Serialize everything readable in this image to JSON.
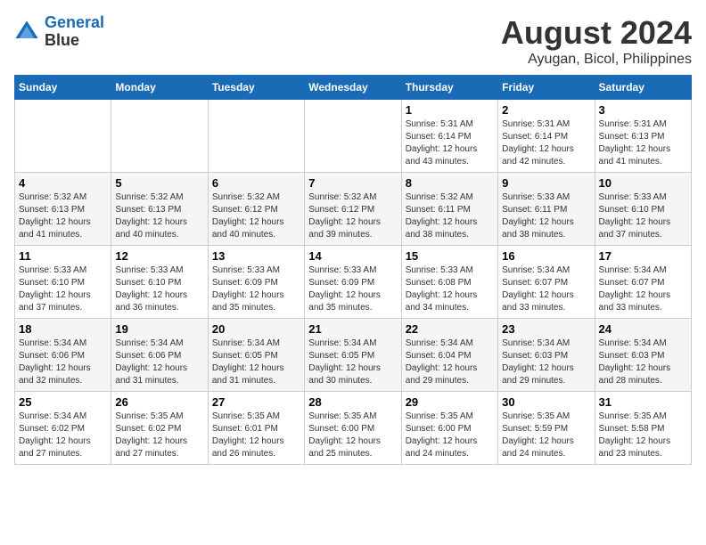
{
  "app": {
    "name": "GeneralBlue",
    "logo_text_line1": "General",
    "logo_text_line2": "Blue"
  },
  "calendar": {
    "title": "August 2024",
    "subtitle": "Ayugan, Bicol, Philippines",
    "days_of_week": [
      "Sunday",
      "Monday",
      "Tuesday",
      "Wednesday",
      "Thursday",
      "Friday",
      "Saturday"
    ],
    "weeks": [
      [
        {
          "day": "",
          "sunrise": "",
          "sunset": "",
          "daylight": ""
        },
        {
          "day": "",
          "sunrise": "",
          "sunset": "",
          "daylight": ""
        },
        {
          "day": "",
          "sunrise": "",
          "sunset": "",
          "daylight": ""
        },
        {
          "day": "",
          "sunrise": "",
          "sunset": "",
          "daylight": ""
        },
        {
          "day": "1",
          "sunrise": "Sunrise: 5:31 AM",
          "sunset": "Sunset: 6:14 PM",
          "daylight": "Daylight: 12 hours and 43 minutes."
        },
        {
          "day": "2",
          "sunrise": "Sunrise: 5:31 AM",
          "sunset": "Sunset: 6:14 PM",
          "daylight": "Daylight: 12 hours and 42 minutes."
        },
        {
          "day": "3",
          "sunrise": "Sunrise: 5:31 AM",
          "sunset": "Sunset: 6:13 PM",
          "daylight": "Daylight: 12 hours and 41 minutes."
        }
      ],
      [
        {
          "day": "4",
          "sunrise": "Sunrise: 5:32 AM",
          "sunset": "Sunset: 6:13 PM",
          "daylight": "Daylight: 12 hours and 41 minutes."
        },
        {
          "day": "5",
          "sunrise": "Sunrise: 5:32 AM",
          "sunset": "Sunset: 6:13 PM",
          "daylight": "Daylight: 12 hours and 40 minutes."
        },
        {
          "day": "6",
          "sunrise": "Sunrise: 5:32 AM",
          "sunset": "Sunset: 6:12 PM",
          "daylight": "Daylight: 12 hours and 40 minutes."
        },
        {
          "day": "7",
          "sunrise": "Sunrise: 5:32 AM",
          "sunset": "Sunset: 6:12 PM",
          "daylight": "Daylight: 12 hours and 39 minutes."
        },
        {
          "day": "8",
          "sunrise": "Sunrise: 5:32 AM",
          "sunset": "Sunset: 6:11 PM",
          "daylight": "Daylight: 12 hours and 38 minutes."
        },
        {
          "day": "9",
          "sunrise": "Sunrise: 5:33 AM",
          "sunset": "Sunset: 6:11 PM",
          "daylight": "Daylight: 12 hours and 38 minutes."
        },
        {
          "day": "10",
          "sunrise": "Sunrise: 5:33 AM",
          "sunset": "Sunset: 6:10 PM",
          "daylight": "Daylight: 12 hours and 37 minutes."
        }
      ],
      [
        {
          "day": "11",
          "sunrise": "Sunrise: 5:33 AM",
          "sunset": "Sunset: 6:10 PM",
          "daylight": "Daylight: 12 hours and 37 minutes."
        },
        {
          "day": "12",
          "sunrise": "Sunrise: 5:33 AM",
          "sunset": "Sunset: 6:10 PM",
          "daylight": "Daylight: 12 hours and 36 minutes."
        },
        {
          "day": "13",
          "sunrise": "Sunrise: 5:33 AM",
          "sunset": "Sunset: 6:09 PM",
          "daylight": "Daylight: 12 hours and 35 minutes."
        },
        {
          "day": "14",
          "sunrise": "Sunrise: 5:33 AM",
          "sunset": "Sunset: 6:09 PM",
          "daylight": "Daylight: 12 hours and 35 minutes."
        },
        {
          "day": "15",
          "sunrise": "Sunrise: 5:33 AM",
          "sunset": "Sunset: 6:08 PM",
          "daylight": "Daylight: 12 hours and 34 minutes."
        },
        {
          "day": "16",
          "sunrise": "Sunrise: 5:34 AM",
          "sunset": "Sunset: 6:07 PM",
          "daylight": "Daylight: 12 hours and 33 minutes."
        },
        {
          "day": "17",
          "sunrise": "Sunrise: 5:34 AM",
          "sunset": "Sunset: 6:07 PM",
          "daylight": "Daylight: 12 hours and 33 minutes."
        }
      ],
      [
        {
          "day": "18",
          "sunrise": "Sunrise: 5:34 AM",
          "sunset": "Sunset: 6:06 PM",
          "daylight": "Daylight: 12 hours and 32 minutes."
        },
        {
          "day": "19",
          "sunrise": "Sunrise: 5:34 AM",
          "sunset": "Sunset: 6:06 PM",
          "daylight": "Daylight: 12 hours and 31 minutes."
        },
        {
          "day": "20",
          "sunrise": "Sunrise: 5:34 AM",
          "sunset": "Sunset: 6:05 PM",
          "daylight": "Daylight: 12 hours and 31 minutes."
        },
        {
          "day": "21",
          "sunrise": "Sunrise: 5:34 AM",
          "sunset": "Sunset: 6:05 PM",
          "daylight": "Daylight: 12 hours and 30 minutes."
        },
        {
          "day": "22",
          "sunrise": "Sunrise: 5:34 AM",
          "sunset": "Sunset: 6:04 PM",
          "daylight": "Daylight: 12 hours and 29 minutes."
        },
        {
          "day": "23",
          "sunrise": "Sunrise: 5:34 AM",
          "sunset": "Sunset: 6:03 PM",
          "daylight": "Daylight: 12 hours and 29 minutes."
        },
        {
          "day": "24",
          "sunrise": "Sunrise: 5:34 AM",
          "sunset": "Sunset: 6:03 PM",
          "daylight": "Daylight: 12 hours and 28 minutes."
        }
      ],
      [
        {
          "day": "25",
          "sunrise": "Sunrise: 5:34 AM",
          "sunset": "Sunset: 6:02 PM",
          "daylight": "Daylight: 12 hours and 27 minutes."
        },
        {
          "day": "26",
          "sunrise": "Sunrise: 5:35 AM",
          "sunset": "Sunset: 6:02 PM",
          "daylight": "Daylight: 12 hours and 27 minutes."
        },
        {
          "day": "27",
          "sunrise": "Sunrise: 5:35 AM",
          "sunset": "Sunset: 6:01 PM",
          "daylight": "Daylight: 12 hours and 26 minutes."
        },
        {
          "day": "28",
          "sunrise": "Sunrise: 5:35 AM",
          "sunset": "Sunset: 6:00 PM",
          "daylight": "Daylight: 12 hours and 25 minutes."
        },
        {
          "day": "29",
          "sunrise": "Sunrise: 5:35 AM",
          "sunset": "Sunset: 6:00 PM",
          "daylight": "Daylight: 12 hours and 24 minutes."
        },
        {
          "day": "30",
          "sunrise": "Sunrise: 5:35 AM",
          "sunset": "Sunset: 5:59 PM",
          "daylight": "Daylight: 12 hours and 24 minutes."
        },
        {
          "day": "31",
          "sunrise": "Sunrise: 5:35 AM",
          "sunset": "Sunset: 5:58 PM",
          "daylight": "Daylight: 12 hours and 23 minutes."
        }
      ]
    ]
  }
}
